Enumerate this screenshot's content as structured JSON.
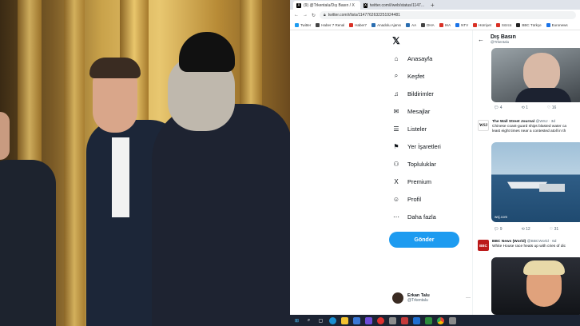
{
  "browser": {
    "tabs": [
      {
        "label": "(9) @Trkentalu/Dış Basın / X",
        "active": true
      },
      {
        "label": "twitter.com/i/web/status/1147...",
        "active": false
      }
    ],
    "url": "twitter.com/i/lists/1147762632251924481",
    "bookmarks": [
      {
        "label": "Twitter",
        "color": "#1d9bf0"
      },
      {
        "label": "Haber 7 Renal",
        "color": "#444"
      },
      {
        "label": "Haber7",
        "color": "#d93025"
      },
      {
        "label": "Anadolu Ajansı",
        "color": "#2a6db0"
      },
      {
        "label": "AA",
        "color": "#2a6db0"
      },
      {
        "label": "DHA",
        "color": "#444"
      },
      {
        "label": "IHA",
        "color": "#d93025"
      },
      {
        "label": "NTV",
        "color": "#1a73e8"
      },
      {
        "label": "Hürriyet",
        "color": "#d93025"
      },
      {
        "label": "Sözcü",
        "color": "#d93025"
      },
      {
        "label": "BBC Türkçe",
        "color": "#222"
      },
      {
        "label": "Euronews",
        "color": "#1a73e8"
      }
    ]
  },
  "nav": {
    "items": [
      {
        "icon": "home-icon",
        "glyph": "⌂",
        "label": "Anasayfa"
      },
      {
        "icon": "search-icon",
        "glyph": "⌕",
        "label": "Keşfet"
      },
      {
        "icon": "bell-icon",
        "glyph": "♫",
        "label": "Bildirimler"
      },
      {
        "icon": "mail-icon",
        "glyph": "✉",
        "label": "Mesajlar"
      },
      {
        "icon": "list-icon",
        "glyph": "☰",
        "label": "Listeler"
      },
      {
        "icon": "bookmark-icon",
        "glyph": "⚑",
        "label": "Yer İşaretleri"
      },
      {
        "icon": "communities-icon",
        "glyph": "⚇",
        "label": "Topluluklar"
      },
      {
        "icon": "x-premium-icon",
        "glyph": "X",
        "label": "Premium"
      },
      {
        "icon": "profile-icon",
        "glyph": "☺",
        "label": "Profil"
      },
      {
        "icon": "more-icon",
        "glyph": "⋯",
        "label": "Daha fazla"
      }
    ],
    "post_label": "Gönder",
    "account": {
      "name": "Erkan Talu",
      "handle": "@Trkentalu"
    }
  },
  "feed": {
    "title": "Dış Basın",
    "handle": "@Trkentalu",
    "tweet0_counts": {
      "replies": "4",
      "retweets": "1",
      "likes": "16"
    },
    "tweet1": {
      "name": "The Wall Street Journal",
      "handle": "@WSJ · 3d",
      "text1": "Chinese coast-guard ships blasted water ca",
      "text2": "least eight times near a contested atoll in th",
      "counts": {
        "replies": "9",
        "retweets": "12",
        "likes": "31"
      },
      "media_caption": "wsj.com"
    },
    "tweet2": {
      "name": "BBC News (World)",
      "handle": "@BBCWorld · 6d",
      "text1": "White House race heats up with cries of dic"
    }
  }
}
